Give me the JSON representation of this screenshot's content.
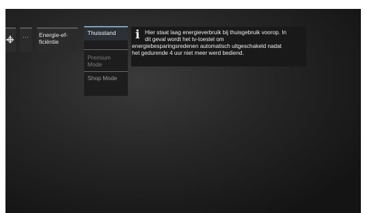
{
  "menu": {
    "settings_icon": "gear-icon",
    "more_label": "···",
    "energy_label": "Energie-ef-\nficiëntie"
  },
  "dropdown": {
    "selected": "Thuisstand",
    "options": [
      "Premium\nMode",
      "Shop Mode"
    ]
  },
  "info": {
    "icon": "info-icon",
    "lines": [
      "Hier staat laag energieverbruik bij thuisgebruik voorop. In",
      "dit geval wordt het tv-toestel om",
      "energiebesparingsredenen automatisch uitgeschakeld nadat",
      "het gedurende 4 uur niet meer werd bediend."
    ]
  },
  "colors": {
    "accent": "#7fa0bb",
    "background": "#1c1c1c"
  }
}
